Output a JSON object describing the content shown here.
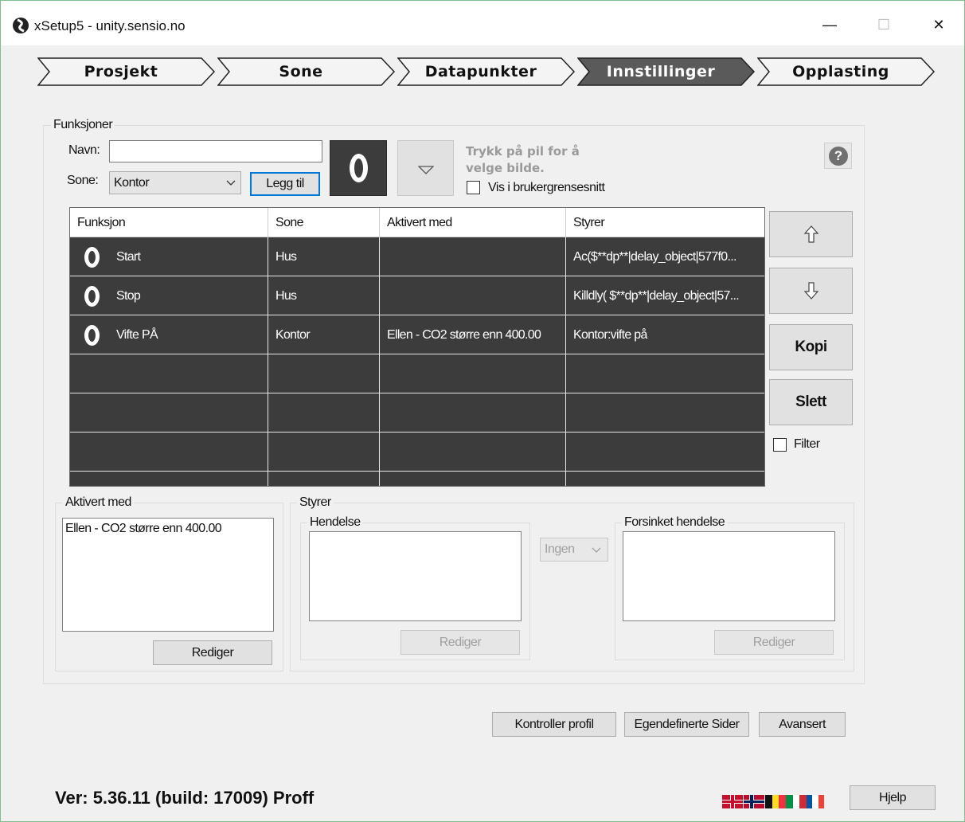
{
  "window": {
    "title": "xSetup5 - unity.sensio.no",
    "controls": {
      "minimize": "—",
      "maximize": "☐",
      "close": "✕"
    }
  },
  "steps": [
    {
      "label": "Prosjekt",
      "active": false
    },
    {
      "label": "Sone",
      "active": false
    },
    {
      "label": "Datapunkter",
      "active": false
    },
    {
      "label": "Innstillinger",
      "active": true
    },
    {
      "label": "Opplasting",
      "active": false
    }
  ],
  "funksjoner": {
    "group_label": "Funksjoner",
    "navn_label": "Navn:",
    "navn_value": "",
    "sone_label": "Sone:",
    "sone_value": "Kontor",
    "legg_til_label": "Legg til",
    "hint": "Trykk på pil for å velge bilde.",
    "vis_label": "Vis i brukergrensesnitt",
    "vis_checked": false,
    "help_icon": "question-icon"
  },
  "table": {
    "columns": [
      "Funksjon",
      "Sone",
      "Aktivert med",
      "Styrer"
    ],
    "rows": [
      {
        "funksjon": "Start",
        "sone": "Hus",
        "aktivert": "",
        "styrer": "Ac($**dp**|delay_object|577f0..."
      },
      {
        "funksjon": "Stop",
        "sone": "Hus",
        "aktivert": "",
        "styrer": "Killdly( $**dp**|delay_object|57..."
      },
      {
        "funksjon": "Vifte PÅ",
        "sone": "Kontor",
        "aktivert": "Ellen - CO2 større enn 400.00",
        "styrer": "Kontor:vifte på"
      }
    ]
  },
  "side_buttons": {
    "up_icon": "arrow-up-icon",
    "down_icon": "arrow-down-icon",
    "kopi": "Kopi",
    "slett": "Slett",
    "filter": "Filter"
  },
  "aktivert_med": {
    "group_label": "Aktivert med",
    "content": "Ellen - CO2 større enn 400.00",
    "rediger": "Rediger"
  },
  "styrer": {
    "group_label": "Styrer",
    "hendelse_label": "Hendelse",
    "hendelse_rediger": "Rediger",
    "ingen": "Ingen",
    "forsinket_label": "Forsinket hendelse",
    "forsinket_rediger": "Rediger"
  },
  "bottom_buttons": {
    "kontroller": "Kontroller profil",
    "egendefinerte": "Egendefinerte Sider",
    "avansert": "Avansert"
  },
  "footer": {
    "version": "Ver: 5.36.11 (build: 17009) Proff",
    "hjelp": "Hjelp",
    "flags": [
      "flag-uk-icon",
      "flag-norway-icon",
      "flag-belgium-icon",
      "flag-italy-icon",
      "flag-france-icon"
    ]
  },
  "colors": {
    "grid_background": "#3c3c3c",
    "active_step": "#5a5a5a"
  }
}
